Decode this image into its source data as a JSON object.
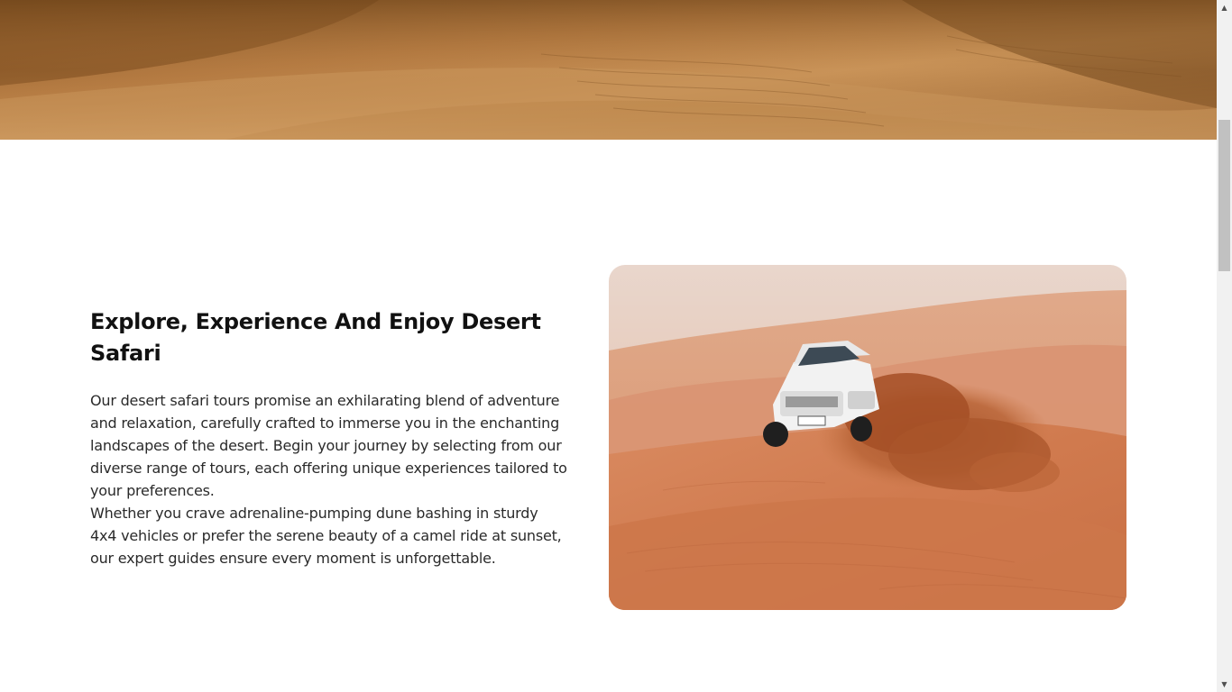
{
  "hero": {
    "image_description_name": "desert-dunes-banner"
  },
  "about": {
    "title": "Explore, Experience And Enjoy Desert Safari",
    "paragraph1": "Our desert safari tours promise an exhilarating blend of adventure and relaxation, carefully crafted to immerse you in the enchanting landscapes of the desert. Begin your journey by selecting from our diverse range of tours, each offering unique experiences tailored to your preferences.",
    "paragraph2": "Whether you crave adrenaline-pumping dune bashing in sturdy 4x4 vehicles or prefer the serene beauty of a camel ride at sunset, our expert guides ensure every moment is unforgettable."
  },
  "scrollbar": {
    "up_arrow": "▲",
    "down_arrow": "▼"
  },
  "colors": {
    "sand_light": "#c48a4e",
    "sand_dark": "#7a4e22",
    "dune_orange": "#d4845a",
    "sky": "#ead2c4",
    "title": "#111111",
    "text": "#2a2a2a"
  }
}
